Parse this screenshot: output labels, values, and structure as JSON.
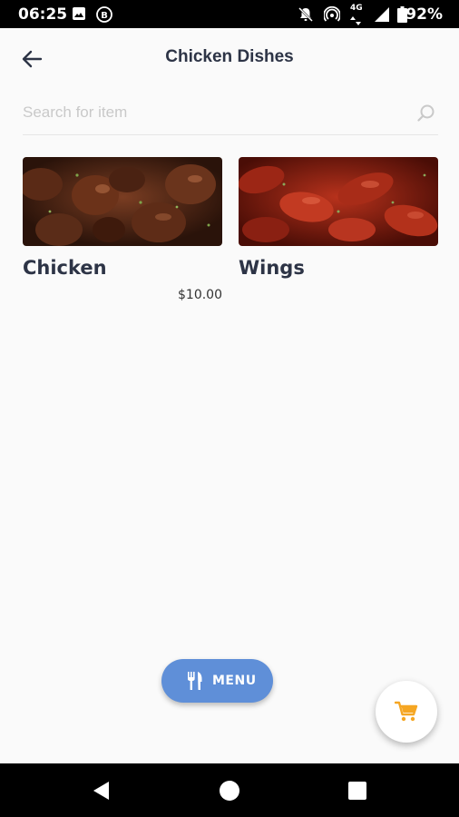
{
  "status_bar": {
    "time": "06:25",
    "battery_percent": "92%",
    "network_label": "4G"
  },
  "app_bar": {
    "title": "Chicken Dishes",
    "back_icon": "arrow-left-icon"
  },
  "search": {
    "placeholder": "Search for item",
    "value": "",
    "icon": "search-icon"
  },
  "items": [
    {
      "name": "Chicken",
      "price": "$10.00"
    },
    {
      "name": "Wings",
      "price": ""
    }
  ],
  "menu_button": {
    "label": "MENU",
    "icon": "fork-knife-icon",
    "color": "#5f8fd8"
  },
  "cart_button": {
    "icon": "shopping-cart-icon",
    "color": "#f5a623"
  },
  "colors": {
    "title": "#2d3446",
    "background": "#fafafa"
  }
}
